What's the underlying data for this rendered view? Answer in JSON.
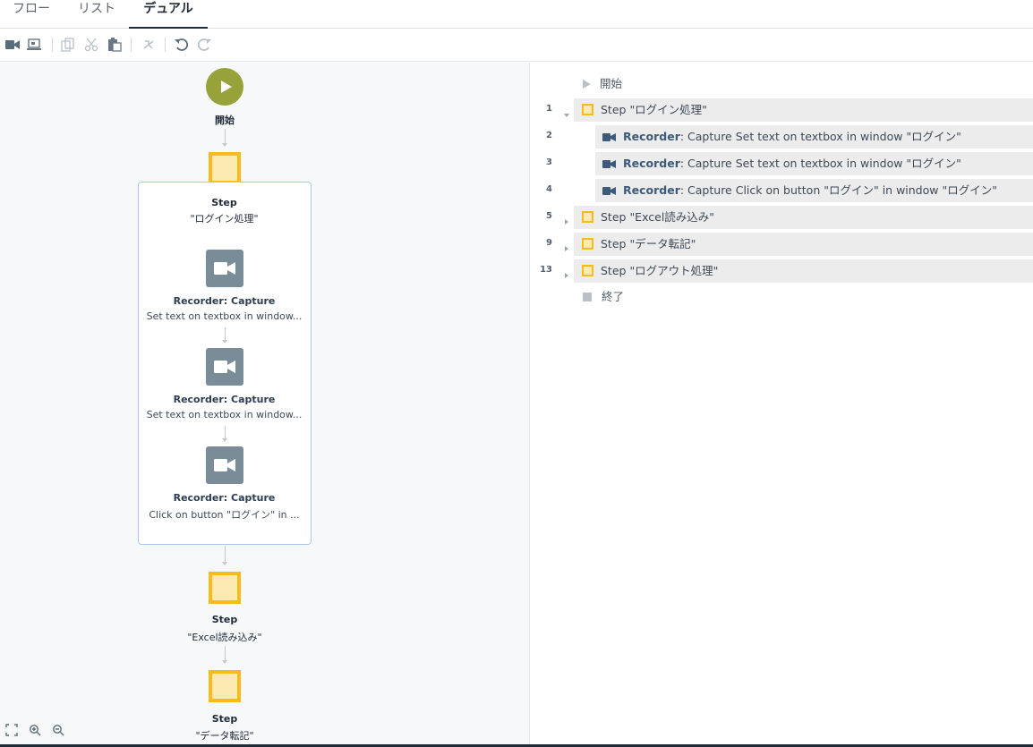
{
  "tabs": [
    {
      "label": "フロー"
    },
    {
      "label": "リスト"
    },
    {
      "label": "デュアル",
      "active": true
    }
  ],
  "toolbar": {
    "icons": [
      "record-video-icon",
      "screen-capture-icon",
      "copy-icon",
      "cut-icon",
      "paste-icon",
      "disable-icon",
      "undo-icon",
      "redo-icon"
    ]
  },
  "flow": {
    "start_label": "開始",
    "group": {
      "title": "Step",
      "name": "\"ログイン処理\""
    },
    "recorders": [
      {
        "title": "Recorder: Capture",
        "desc": "Set text on textbox in window..."
      },
      {
        "title": "Recorder: Capture",
        "desc": "Set text on textbox in window..."
      },
      {
        "title": "Recorder: Capture",
        "desc": "Click on button \"ログイン\" in ..."
      }
    ],
    "steps": [
      {
        "title": "Step",
        "name": "\"Excel読み込み\""
      },
      {
        "title": "Step",
        "name": "\"データ転記\""
      }
    ]
  },
  "list": {
    "start_label": "開始",
    "end_label": "終了",
    "rows": [
      {
        "num": "1",
        "prefix": "Step ",
        "name": "\"ログイン処理\"",
        "expanded": true
      },
      {
        "num": "2",
        "prefix": "Recorder",
        "suffix": ": Capture Set text on textbox in window \"ログイン\""
      },
      {
        "num": "3",
        "prefix": "Recorder",
        "suffix": ": Capture Set text on textbox in window \"ログイン\""
      },
      {
        "num": "4",
        "prefix": "Recorder",
        "suffix": ": Capture Click on button \"ログイン\" in window \"ログイン\""
      },
      {
        "num": "5",
        "prefix": "Step ",
        "name": "\"Excel読み込み\""
      },
      {
        "num": "9",
        "prefix": "Step ",
        "name": "\"データ転記\""
      },
      {
        "num": "13",
        "prefix": "Step ",
        "name": "\"ログアウト処理\""
      }
    ]
  },
  "colors": {
    "start_green": "#97a23a",
    "step_border": "#f7bb1a",
    "step_fill": "#fde9b2",
    "recorder_gray": "#7b8c99",
    "group_border": "#a8c8e6"
  }
}
